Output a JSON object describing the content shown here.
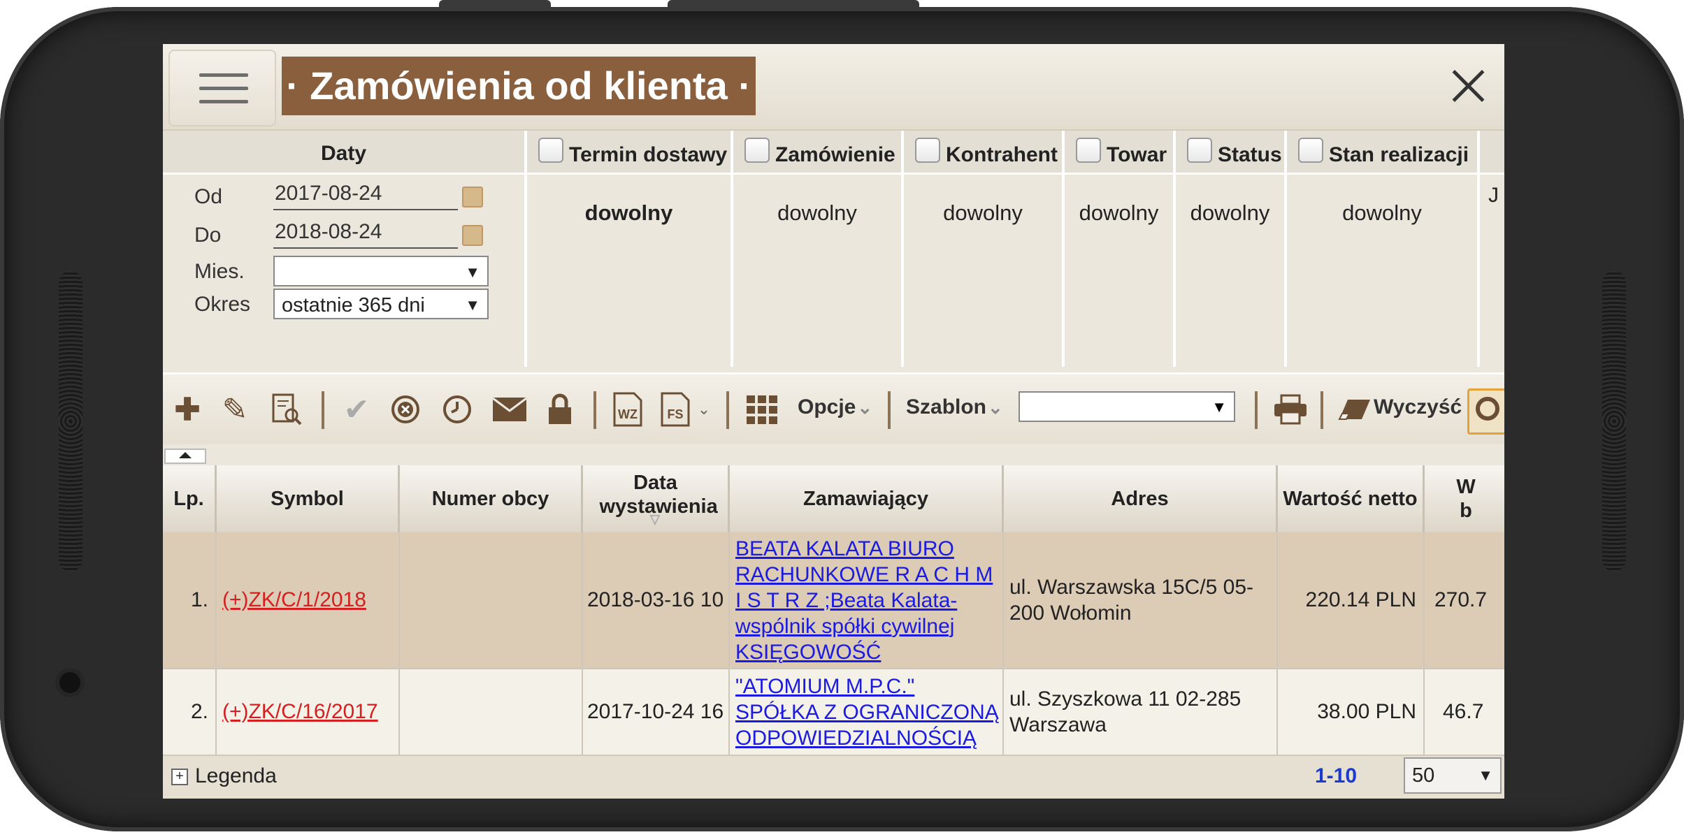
{
  "window": {
    "title": "· Zamówienia od klienta ·"
  },
  "filters": {
    "dates": {
      "header": "Daty",
      "from_label": "Od",
      "from_value": "2017-08-24",
      "to_label": "Do",
      "to_value": "2018-08-24",
      "month_label": "Mies.",
      "month_value": "",
      "period_label": "Okres",
      "period_value": "ostatnie 365 dni"
    },
    "columns": [
      {
        "label": "Termin dostawy",
        "value": "dowolny"
      },
      {
        "label": "Zamówienie",
        "value": "dowolny"
      },
      {
        "label": "Kontrahent",
        "value": "dowolny"
      },
      {
        "label": "Towar",
        "value": "dowolny"
      },
      {
        "label": "Status",
        "value": "dowolny"
      },
      {
        "label": "Stan realizacji",
        "value": "dowolny"
      }
    ],
    "cut_off_value": "J"
  },
  "toolbar": {
    "options_label": "Opcje",
    "template_label": "Szablon",
    "template_value": "",
    "clear_label": "Wyczyść",
    "wz_label": "WZ",
    "fs_label": "FS"
  },
  "table": {
    "headers": [
      "Lp.",
      "Symbol",
      "Numer obcy",
      "Data wystawienia",
      "Zamawiający",
      "Adres",
      "Wartość netto",
      "W b"
    ],
    "rows": [
      {
        "lp": "1.",
        "symbol": "(+)ZK/C/1/2018",
        "numer_obcy": "",
        "data": "2018-03-16 10",
        "zamawiajacy": "BEATA KALATA BIURO RACHUNKOWE R A C H M I S T R Z ;Beata Kalata-wspólnik spółki cywilnej KSIĘGOWOŚĆ",
        "adres": "ul. Warszawska 15C/5 05-200 Wołomin",
        "netto": "220.14 PLN",
        "brutto": "270.7"
      },
      {
        "lp": "2.",
        "symbol": "(+)ZK/C/16/2017",
        "numer_obcy": "",
        "data": "2017-10-24 16",
        "zamawiajacy": "\"ATOMIUM M.P.C.\" SPÓŁKA Z OGRANICZONĄ ODPOWIEDZIALNOŚCIĄ",
        "adres": "ul. Szyszkowa 11 02-285 Warszawa",
        "netto": "38.00 PLN",
        "brutto": "46.7"
      }
    ]
  },
  "footer": {
    "legend_label": "Legenda",
    "pages_label": "1-10",
    "per_page_value": "50"
  },
  "colors": {
    "title_bg": "#8a5f3e",
    "link_red": "#d42020",
    "link_blue": "#1a1ae0",
    "row_highlight": "#dccbb5",
    "row_normal": "#f4f2e8"
  }
}
